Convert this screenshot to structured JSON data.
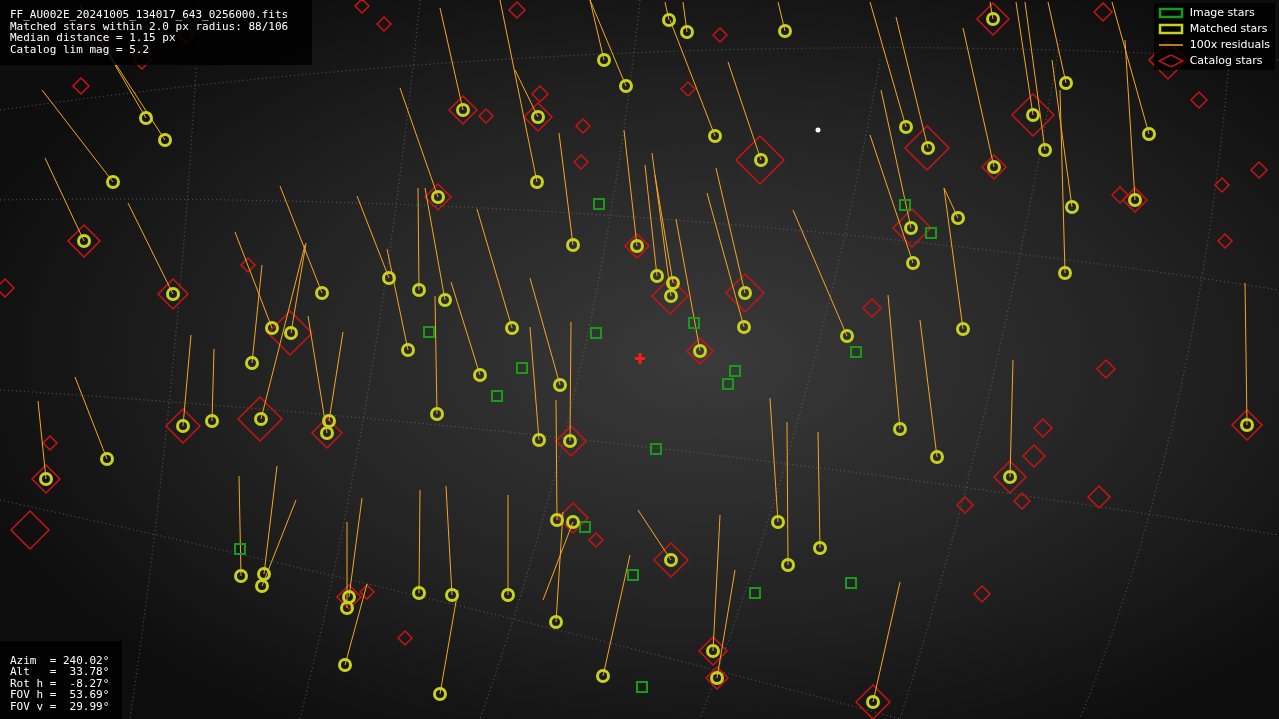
{
  "header": {
    "lines": [
      "FF_AU002E_20241005_134017_643_0256000.fits",
      "Matched stars within 2.0 px radius: 88/106",
      "Median distance = 1.15 px",
      "Catalog lim mag = 5.2"
    ]
  },
  "legend": [
    {
      "kind": "image",
      "label": "Image stars"
    },
    {
      "kind": "matched",
      "label": "Matched stars"
    },
    {
      "kind": "residual",
      "label": "100x residuals"
    },
    {
      "kind": "catalog",
      "label": "Catalog stars"
    }
  ],
  "pointing": {
    "lines": [
      "Azim  = 240.02°",
      "Alt   =  33.78°",
      "Rot h =  -8.27°",
      "FOV h =  53.69°",
      "FOV v =  29.99°"
    ]
  }
}
